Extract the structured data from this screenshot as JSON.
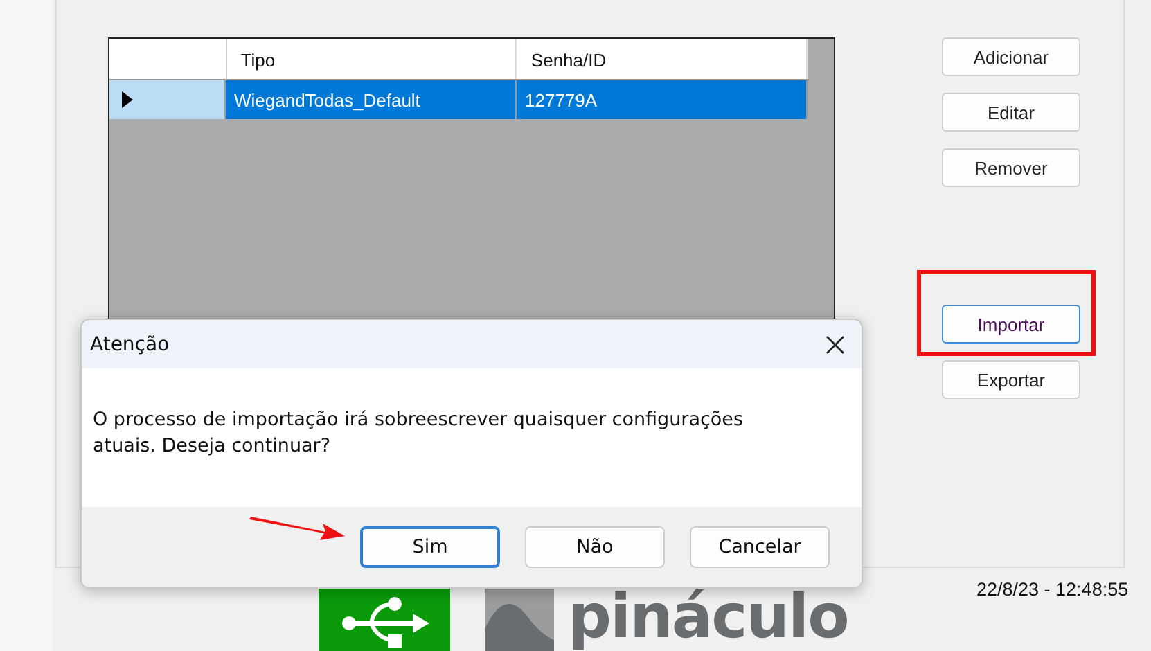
{
  "grid": {
    "columns": [
      "Tipo",
      "Senha/ID"
    ],
    "rows": [
      {
        "cells": [
          "WiegandTodas_Default",
          "127779A"
        ],
        "selected": true,
        "current": true
      }
    ]
  },
  "side_buttons": [
    {
      "label": "Adicionar",
      "focused": false,
      "highlighted": false
    },
    {
      "label": "Editar",
      "focused": false,
      "highlighted": false
    },
    {
      "label": "Remover",
      "focused": false,
      "highlighted": false
    },
    {
      "label": "Importar",
      "focused": true,
      "highlighted": true
    },
    {
      "label": "Exportar",
      "focused": false,
      "highlighted": false
    }
  ],
  "dialog": {
    "title": "Atenção",
    "message": "O processo de importação irá sobreescrever quaisquer configurações atuais. Deseja continuar?",
    "buttons": [
      {
        "label": "Sim",
        "default": true,
        "pointed": true
      },
      {
        "label": "Não",
        "default": false,
        "pointed": false
      },
      {
        "label": "Cancelar",
        "default": false,
        "pointed": false
      }
    ]
  },
  "footer": {
    "logo_text": "pináculo",
    "timestamp": "22/8/23 - 12:48:55"
  }
}
